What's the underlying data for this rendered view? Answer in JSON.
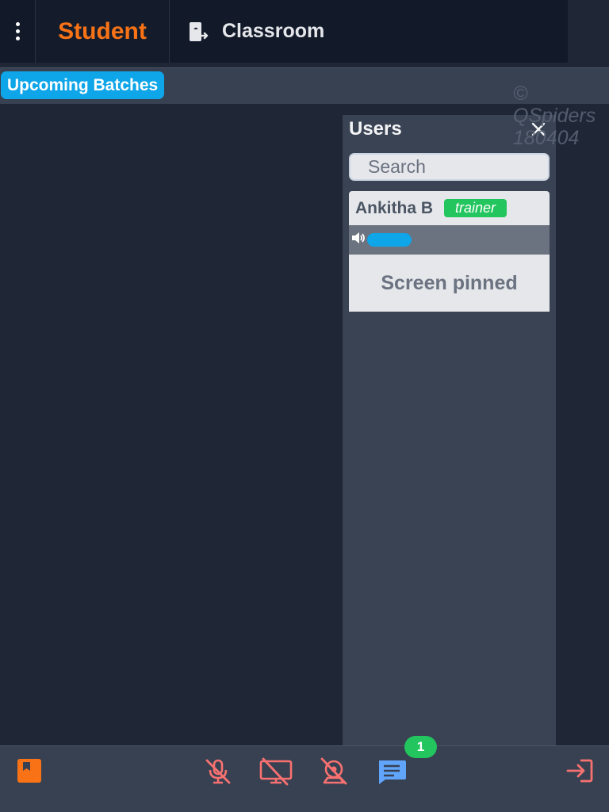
{
  "header": {
    "tabs": [
      {
        "label": "Student",
        "active": true,
        "color": "#f97316"
      },
      {
        "label": "Classroom",
        "icon": "classroom-exit-icon"
      }
    ],
    "menu_icon": "kebab-menu-icon"
  },
  "subbar": {
    "upcoming_label": "Upcoming Batches"
  },
  "watermark": {
    "line1": "©",
    "line2": "QSpiders",
    "line3": "180404"
  },
  "users_panel": {
    "title": "Users",
    "close_icon": "close-icon",
    "search": {
      "placeholder": "Search",
      "value": ""
    },
    "users": [
      {
        "name": "Ankitha B",
        "role": "trainer",
        "audio_icon": "speaker-icon",
        "status": "Screen pinned"
      }
    ]
  },
  "toolbar": {
    "items": [
      {
        "icon": "notebook-icon",
        "color": "#f97316"
      },
      {
        "icon": "mic-off-icon",
        "color": "#f87171"
      },
      {
        "icon": "screen-share-off-icon",
        "color": "#f87171"
      },
      {
        "icon": "camera-off-icon",
        "color": "#f87171"
      },
      {
        "icon": "chat-icon",
        "color": "#60a5fa"
      },
      {
        "icon": "exit-icon",
        "color": "#f87171"
      }
    ],
    "chat_badge": "1"
  }
}
